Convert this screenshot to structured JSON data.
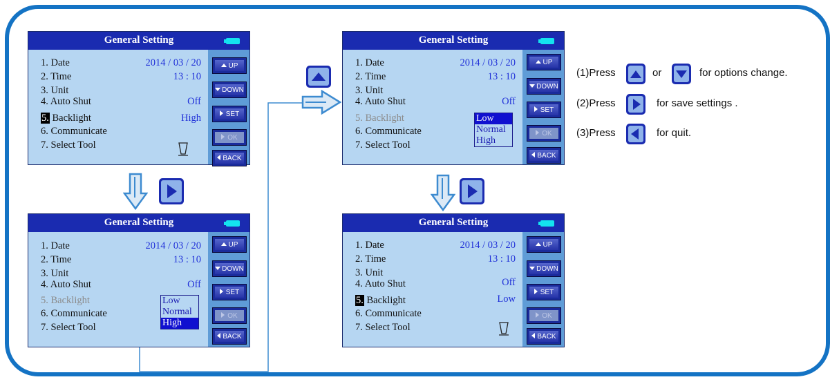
{
  "colors": {
    "frame": "#1473c4",
    "title_bar": "#1a2bb0",
    "panel_bg": "#b6d6f2",
    "value_text": "#2131d8",
    "sidebar": "#5f9cd7"
  },
  "screens": [
    {
      "title": "General Setting",
      "items": [
        "1. Date",
        "2. Time",
        "3. Unit",
        "4. Auto Shut",
        "Backlight",
        "6. Communicate",
        "7.  Select Tool"
      ],
      "selected_number": "5.",
      "values": {
        "date": "2014 / 03 / 20",
        "time": "13 : 10",
        "auto_shut": "Off",
        "backlight": "High"
      },
      "buttons": [
        "UP",
        "DOWN",
        "SET",
        "OK",
        "BACK"
      ]
    },
    {
      "title": "General Setting",
      "items": [
        "1. Date",
        "2. Time",
        "3. Unit",
        "4. Auto Shut",
        "5. Backlight",
        "6. Communicate",
        "7.  Select Tool"
      ],
      "values": {
        "date": "2014 / 03 / 20",
        "time": "13 : 10",
        "auto_shut": "Off"
      },
      "dropdown": [
        "Low",
        "Normal",
        "High"
      ],
      "dropdown_selected": "High",
      "buttons": [
        "UP",
        "DOWN",
        "SET",
        "OK",
        "BACK"
      ]
    },
    {
      "title": "General Setting",
      "items": [
        "1. Date",
        "2. Time",
        "3. Unit",
        "4. Auto Shut",
        "5. Backlight",
        "6. Communicate",
        "7.  Select Tool"
      ],
      "values": {
        "date": "2014 / 03 / 20",
        "time": "13 : 10",
        "auto_shut": "Off"
      },
      "dropdown": [
        "Low",
        "Normal",
        "High"
      ],
      "dropdown_selected": "Low",
      "buttons": [
        "UP",
        "DOWN",
        "SET",
        "OK",
        "BACK"
      ]
    },
    {
      "title": "General Setting",
      "items": [
        "1. Date",
        "2. Time",
        "3. Unit",
        "4. Auto Shut",
        "Backlight",
        "6. Communicate",
        "7.  Select Tool"
      ],
      "selected_number": "5.",
      "values": {
        "date": "2014 / 03 / 20",
        "time": "13 : 10",
        "auto_shut": "Off",
        "backlight": "Low"
      },
      "buttons": [
        "UP",
        "DOWN",
        "SET",
        "OK",
        "BACK"
      ]
    }
  ],
  "instructions": {
    "line1_a": "(1)Press",
    "line1_b": "or",
    "line1_c": "for options change.",
    "line2_a": "(2)Press",
    "line2_c": "for save settings .",
    "line3_a": "(3)Press",
    "line3_c": "for quit."
  },
  "icons": [
    "up-key-icon",
    "down-key-icon",
    "right-key-icon",
    "left-key-icon",
    "down-arrow-icon",
    "right-arrow-icon",
    "select-tool-icon",
    "battery-icon"
  ]
}
